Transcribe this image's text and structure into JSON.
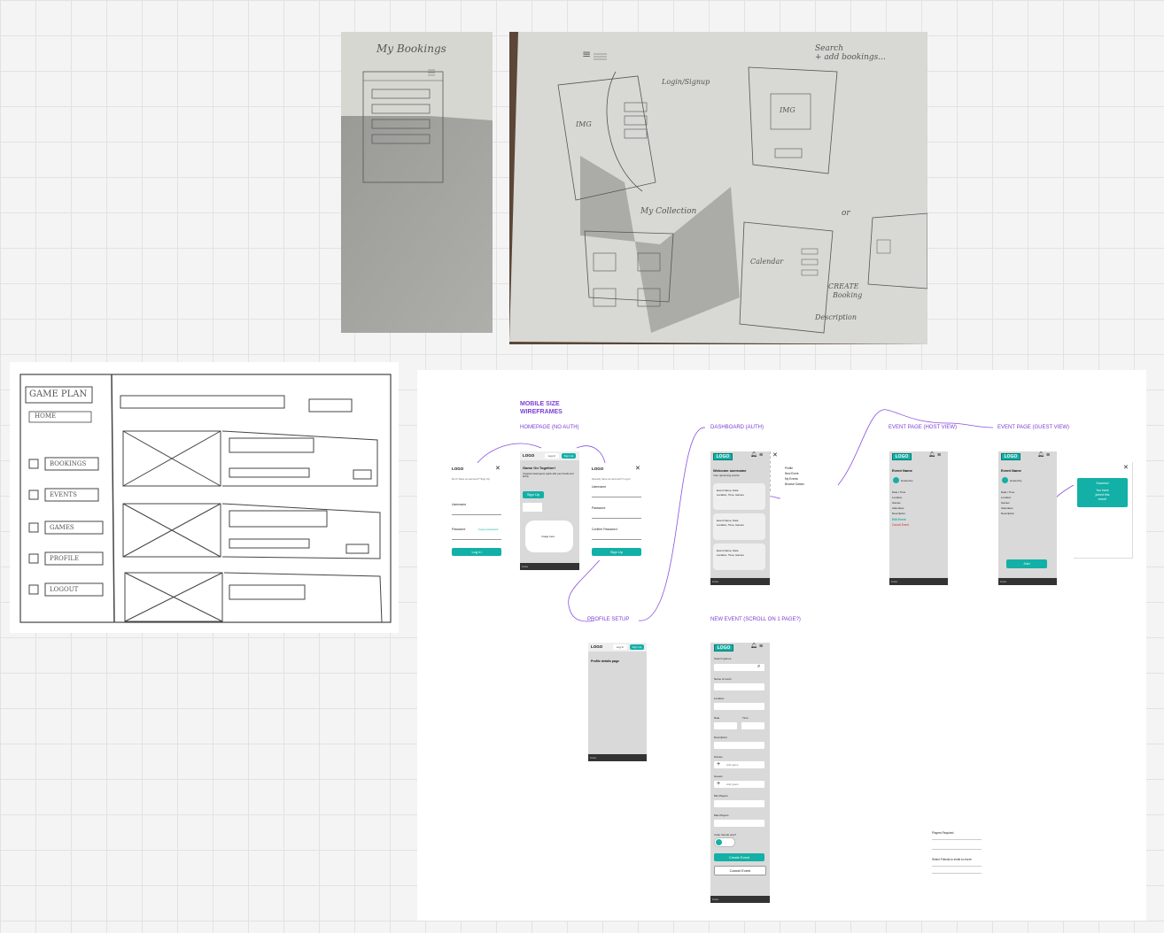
{
  "sketch_top_left": {
    "title": "My Bookings"
  },
  "sketch_top_right": {
    "hamburger": "≡",
    "login_note": "Login/Signup",
    "img_label": "IMG",
    "search_note_line1": "Search",
    "search_note_line2": "+ add bookings...",
    "img_label_2": "IMG",
    "my_collection": "My Collection",
    "calendar_label": "Calendar",
    "create_booking_line1": "CREATE",
    "create_booking_line2": "Booking",
    "or_label": "or",
    "description_label": "Description"
  },
  "sketch_left": {
    "title": "GAME PLAN",
    "subtitle": "HOME",
    "nav": [
      "BOOKINGS",
      "EVENTS",
      "GAMES",
      "PROFILE",
      "LOGOUT"
    ]
  },
  "board": {
    "header_line1": "MOBILE SIZE",
    "header_line2": "WIREFRAMES",
    "homepage_label": "HOMEPAGE (no auth)",
    "dashboard_label": "DASHBOARD (auth)",
    "event_host_label": "EVENT PAGE (host view)",
    "event_guest_label": "EVENT PAGE (guest view)",
    "profile_setup_label": "PROFILE SETUP",
    "new_event_label": "NEW EVENT (scroll on 1 page?)",
    "login": {
      "logo": "LOGO",
      "close": "✕",
      "subtitle": "Don't have an account? Sign Up",
      "username": "Username",
      "password": "Password",
      "forgot": "Forgot password",
      "button": "Log In"
    },
    "home": {
      "logo": "LOGO",
      "tab_login": "Log In",
      "tab_signup": "Sign Up",
      "heading": "Game On Together!",
      "body": "Organise board game nights with your friends and family",
      "signup_button": "Sign Up",
      "image_label": "Image here",
      "footer": "Footer"
    },
    "signup": {
      "logo": "LOGO",
      "close": "✕",
      "subtitle": "Already have an account? Log In",
      "username": "Username",
      "password": "Password",
      "confirm": "Confirm Password",
      "button": "Sign Up"
    },
    "dashboard": {
      "logo": "LOGO",
      "welcome": "Welcome username",
      "sub": "Your upcoming events",
      "cards": [
        {
          "title": "Event Name, Date",
          "body": "Location, Time, Games"
        },
        {
          "title": "Event Name, Date",
          "body": "Location, Time, Games"
        },
        {
          "title": "Event Name, Date",
          "body": "Location, Time, Games"
        }
      ],
      "footer": "Footer",
      "menu_items": [
        "Profile",
        "New Event",
        "My Events",
        "Browse Games"
      ]
    },
    "event_host": {
      "logo": "LOGO",
      "title": "Event Name",
      "host": "Hosted by",
      "details": [
        "Date / Time",
        "Location",
        "Games",
        "Attendees",
        "Description"
      ],
      "edit": "Edit Event",
      "cancel": "Cancel Event",
      "footer": "Footer"
    },
    "event_guest": {
      "logo": "LOGO",
      "title": "Event Name",
      "host": "Hosted by",
      "details": [
        "Date / Time",
        "Location",
        "Games",
        "Attendees",
        "Description"
      ],
      "join": "Join",
      "footer": "Footer"
    },
    "joined_modal": {
      "close": "✕",
      "title": "Success!",
      "message_line1": "You have",
      "message_line2": "joined this",
      "message_line3": "event!"
    },
    "profile": {
      "logo": "LOGO",
      "tab_login": "Log In",
      "tab_signup": "Sign Up",
      "title": "Profile details page",
      "footer": "Footer"
    },
    "new_event": {
      "logo": "LOGO",
      "search": "Search games",
      "fields": [
        "Name of event",
        "Location",
        "Date",
        "Time",
        "Description",
        "Games",
        "Guests",
        "Min Players",
        "Max Players"
      ],
      "add_game": "Add game",
      "add_guest": "Add guest",
      "toggle_label": "Invite friends only?",
      "primary_button": "Create Event",
      "secondary_button": "Cancel Event",
      "footer": "Footer"
    },
    "loose_fields": [
      "Players Required",
      "Select Friends to invite to event"
    ]
  }
}
